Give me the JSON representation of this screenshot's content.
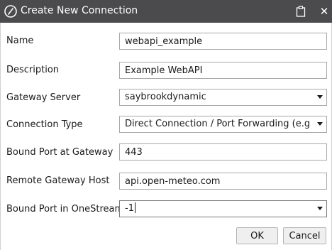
{
  "window": {
    "title": "Create New Connection",
    "logo_icon": "onestream-logo-icon",
    "clipboard_icon": "clipboard-icon",
    "close_icon": "close-icon",
    "close_glyph": "✕",
    "titlebar_color": "#4b4b4d"
  },
  "form": {
    "name": {
      "label": "Name",
      "value": "webapi_example"
    },
    "description": {
      "label": "Description",
      "value": "Example WebAPI"
    },
    "gateway_server": {
      "label": "Gateway Server",
      "value": "saybrookdynamic"
    },
    "connection_type": {
      "label": "Connection Type",
      "value": "Direct Connection / Port Forwarding (e.g. S..."
    },
    "bound_port_gateway": {
      "label": "Bound Port at Gateway",
      "value": "443"
    },
    "remote_gateway_host": {
      "label": "Remote Gateway Host",
      "value": "api.open-meteo.com"
    },
    "bound_port_onestream": {
      "label": "Bound Port in OneStream",
      "value": "-1"
    }
  },
  "buttons": {
    "ok": "OK",
    "cancel": "Cancel"
  }
}
